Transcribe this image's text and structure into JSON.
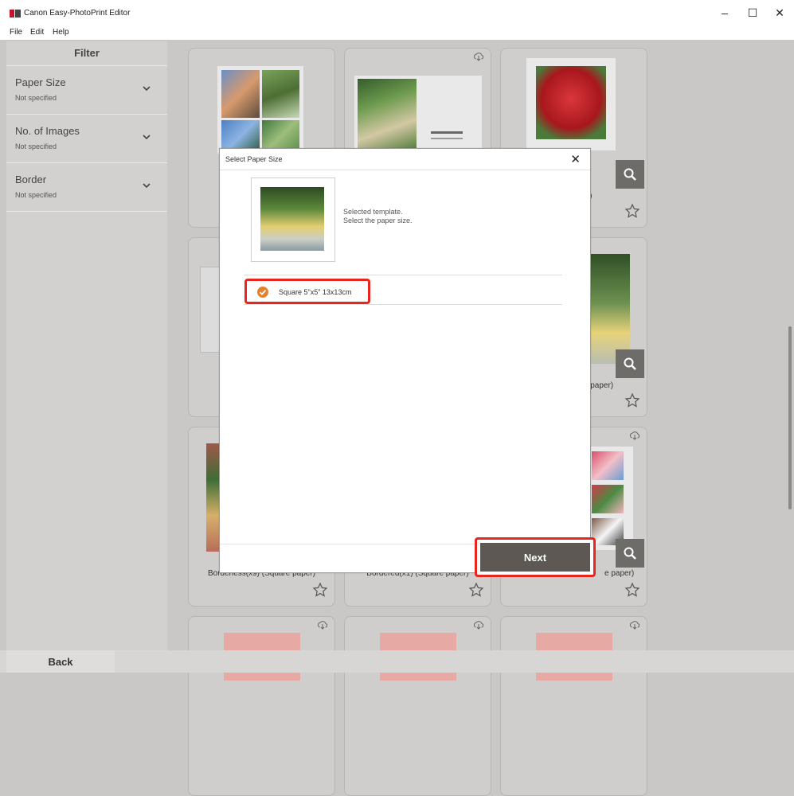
{
  "window": {
    "title": "Canon Easy-PhotoPrint Editor",
    "minimize": "–",
    "maximize": "☐",
    "close": "✕"
  },
  "menu": [
    "File",
    "Edit",
    "Help"
  ],
  "sidebar": {
    "heading": "Filter",
    "filters": [
      {
        "label": "Paper Size",
        "value": "Not specified"
      },
      {
        "label": "No. of Images",
        "value": "Not specified"
      },
      {
        "label": "Border",
        "value": "Not specified"
      }
    ]
  },
  "cards": {
    "partial_labels": {
      "row1_col3": "p)",
      "row2_col3": "are paper)",
      "row3_col1": "Borderless(x9) (Square paper)",
      "row3_col2": "Bordered(x1) (Square paper)",
      "row3_col3": "e paper)"
    }
  },
  "dialog": {
    "title": "Select Paper Size",
    "close": "✕",
    "template_caption_1": "Selected template.",
    "template_caption_2": "Select the paper size.",
    "paper_option": "Square 5\"x5\" 13x13cm",
    "next_label": "Next"
  },
  "footer": {
    "back_label": "Back"
  },
  "colors": {
    "highlight": "#e8261f",
    "check": "#e6812b",
    "next_button": "#5d5853"
  }
}
